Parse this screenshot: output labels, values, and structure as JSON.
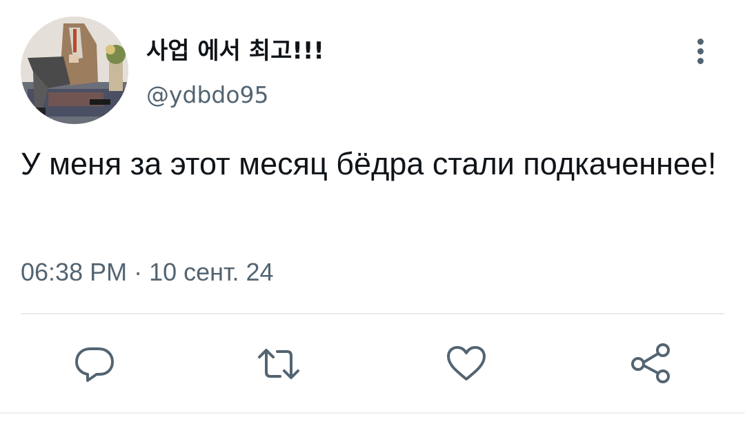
{
  "user": {
    "display_name": "사업 에서 최고!!!",
    "handle": "@ydbdo95"
  },
  "tweet": {
    "text": "У меня за этот месяц бёдра стали подкаченнее!",
    "timestamp": "06:38 PM · 10 сент. 24"
  },
  "icons": {
    "more": "more-vertical-icon",
    "reply": "reply-icon",
    "retweet": "retweet-icon",
    "like": "heart-icon",
    "share": "share-icon"
  },
  "colors": {
    "text": "#0f1419",
    "secondary": "#536471",
    "icon": "#536471",
    "divider": "#e8ebed"
  }
}
